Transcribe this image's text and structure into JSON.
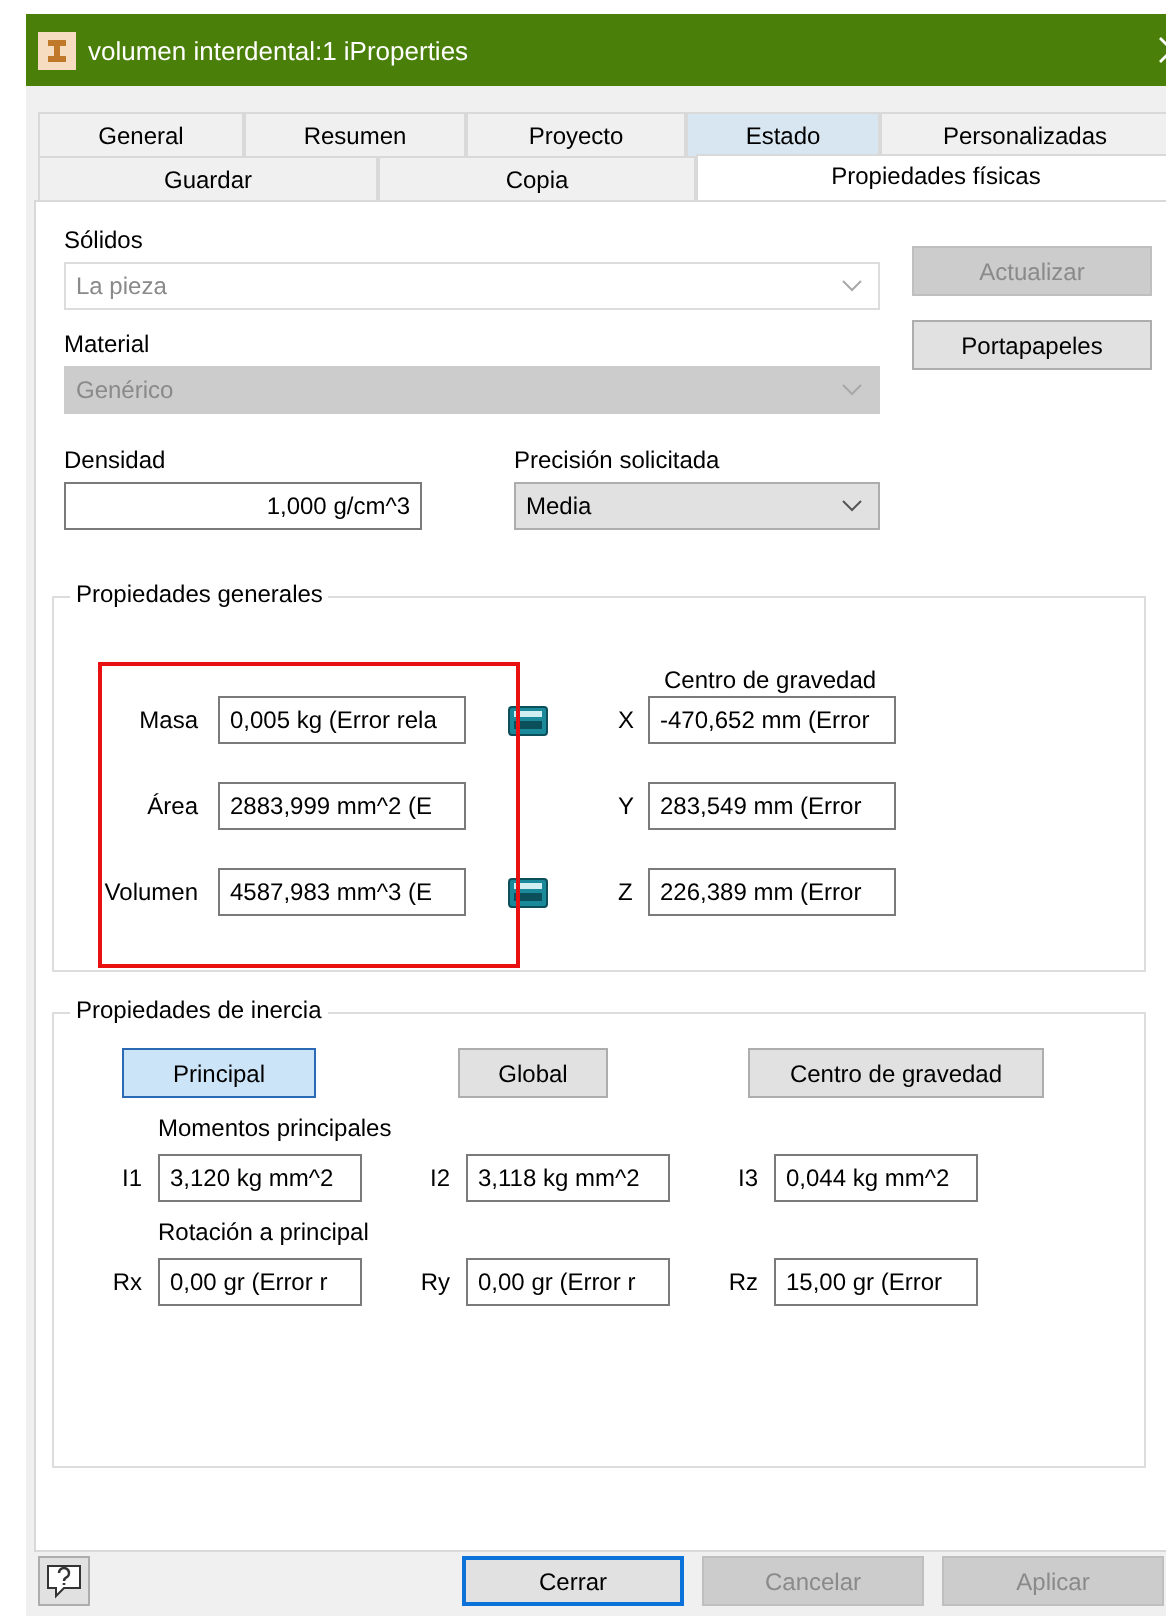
{
  "window": {
    "title": "volumen interdental:1 iProperties"
  },
  "tabs_row_1": [
    {
      "label": "General",
      "selected": false,
      "hovered": false
    },
    {
      "label": "Resumen",
      "selected": false,
      "hovered": false
    },
    {
      "label": "Proyecto",
      "selected": false,
      "hovered": false
    },
    {
      "label": "Estado",
      "selected": false,
      "hovered": true
    },
    {
      "label": "Personalizadas",
      "selected": false,
      "hovered": false
    }
  ],
  "tabs_row_2": [
    {
      "label": "Guardar",
      "selected": false,
      "hovered": false
    },
    {
      "label": "Copia",
      "selected": false,
      "hovered": false
    },
    {
      "label": "Propiedades físicas",
      "selected": true,
      "hovered": false
    }
  ],
  "solids": {
    "label": "Sólidos",
    "value": "La pieza",
    "kind": "list",
    "disabled": true
  },
  "material": {
    "label": "Material",
    "value": "Genérico",
    "kind": "combo",
    "disabled": true
  },
  "side_buttons": [
    {
      "label": "Actualizar",
      "disabled": true
    },
    {
      "label": "Portapapeles",
      "disabled": false
    }
  ],
  "density": {
    "label": "Densidad",
    "value": "1,000 g/cm^3"
  },
  "precision": {
    "label": "Precisión solicitada",
    "value": "Media",
    "kind": "combo",
    "disabled": false
  },
  "general": {
    "title": "Propiedades generales",
    "center_title": "Centro de gravedad",
    "rows": [
      {
        "label": "Masa",
        "value": "0,005 kg (Error rela",
        "calculator": true,
        "axis": "X",
        "axis_value": "-470,652 mm (Error"
      },
      {
        "label": "Área",
        "value": "2883,999 mm^2 (E",
        "calculator": false,
        "axis": "Y",
        "axis_value": "283,549 mm (Error"
      },
      {
        "label": "Volumen",
        "value": "4587,983 mm^3 (E",
        "calculator": true,
        "axis": "Z",
        "axis_value": "226,389 mm (Error"
      }
    ]
  },
  "inertia": {
    "title": "Propiedades de inercia",
    "modes": [
      {
        "label": "Principal",
        "selected": true
      },
      {
        "label": "Global",
        "selected": false
      },
      {
        "label": "Centro de gravedad",
        "selected": false
      }
    ],
    "moments_title": "Momentos principales",
    "moments": [
      {
        "label": "I1",
        "value": "3,120 kg mm^2"
      },
      {
        "label": "I2",
        "value": "3,118 kg mm^2"
      },
      {
        "label": "I3",
        "value": "0,044 kg mm^2"
      }
    ],
    "rotation_title": "Rotación a principal",
    "rotations": [
      {
        "label": "Rx",
        "value": "0,00 gr (Error r"
      },
      {
        "label": "Ry",
        "value": "0,00 gr (Error r"
      },
      {
        "label": "Rz",
        "value": "15,00 gr (Error"
      }
    ]
  },
  "footer": {
    "buttons": [
      {
        "label": "Cerrar",
        "default": true,
        "disabled": false
      },
      {
        "label": "Cancelar",
        "default": false,
        "disabled": true
      },
      {
        "label": "Aplicar",
        "default": false,
        "disabled": true
      }
    ]
  }
}
